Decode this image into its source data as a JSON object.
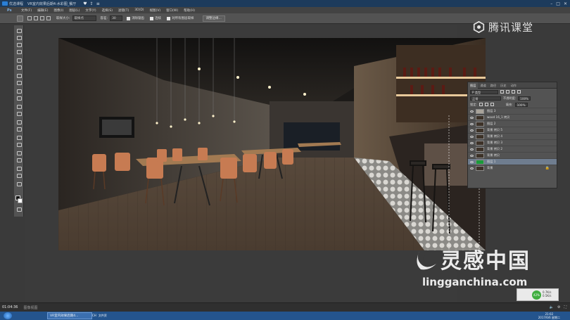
{
  "player": {
    "title": "优选课程",
    "video_title": "VR室内效果后期4:水彩图_餐厅",
    "icons": [
      "heart-icon",
      "share-icon",
      "menu-icon"
    ],
    "window_controls": [
      "minimize-icon",
      "maximize-icon",
      "close-icon"
    ]
  },
  "ps_menu": {
    "logo": "Ps",
    "items": [
      "文件(F)",
      "编辑(E)",
      "图像(I)",
      "图层(L)",
      "文字(Y)",
      "选择(S)",
      "滤镜(T)",
      "3D(D)",
      "视图(V)",
      "窗口(W)",
      "帮助(H)"
    ]
  },
  "ps_options": {
    "sample_size_label": "取样大小:",
    "sample_size_value": "取样点",
    "tolerance_label": "容差:",
    "tolerance_value": "30",
    "anti_alias_label": "消除锯齿",
    "contiguous_label": "连续",
    "sample_all_label": "对所有图层取样",
    "refine_button": "调整边缘..."
  },
  "watermarks": {
    "tencent": "腾讯课堂",
    "lg_brand": "灵感中国",
    "lg_url": "lingganchina.com"
  },
  "layers": {
    "tabs": [
      "图层",
      "通道",
      "路径",
      "历史",
      "动作"
    ],
    "kind_filter": "P 类型",
    "blend_mode": "正常",
    "opacity_label": "不透明度:",
    "opacity_value": "100%",
    "lock_label": "锁定:",
    "fill_label": "填充:",
    "fill_value": "100%",
    "items": [
      {
        "name": "图层 3",
        "thumb": "light"
      },
      {
        "name": "wood 16_1 拷贝",
        "thumb": "dark"
      },
      {
        "name": "图层 2",
        "thumb": "dark"
      },
      {
        "name": "背景 拷贝 5",
        "thumb": "dark"
      },
      {
        "name": "背景 拷贝 4",
        "thumb": "dark"
      },
      {
        "name": "背景 拷贝 3",
        "thumb": "dark"
      },
      {
        "name": "背景 拷贝 2",
        "thumb": "dark"
      },
      {
        "name": "背景 拷贝",
        "thumb": "dark"
      },
      {
        "name": "图层 1",
        "thumb": "green",
        "selected": true
      },
      {
        "name": "背景",
        "thumb": "dark"
      }
    ]
  },
  "status": {
    "time": "01:04:36",
    "doc": "图像视图",
    "net_up": "0.7K/s",
    "net_down": "0.5K/s",
    "badge": "42%"
  },
  "taskbar": {
    "app_label": "VR室内效果后期4...",
    "clock_time": "21:02",
    "clock_date": "2017/6/6 星期二",
    "tray": [
      "CH",
      "文件资"
    ]
  }
}
